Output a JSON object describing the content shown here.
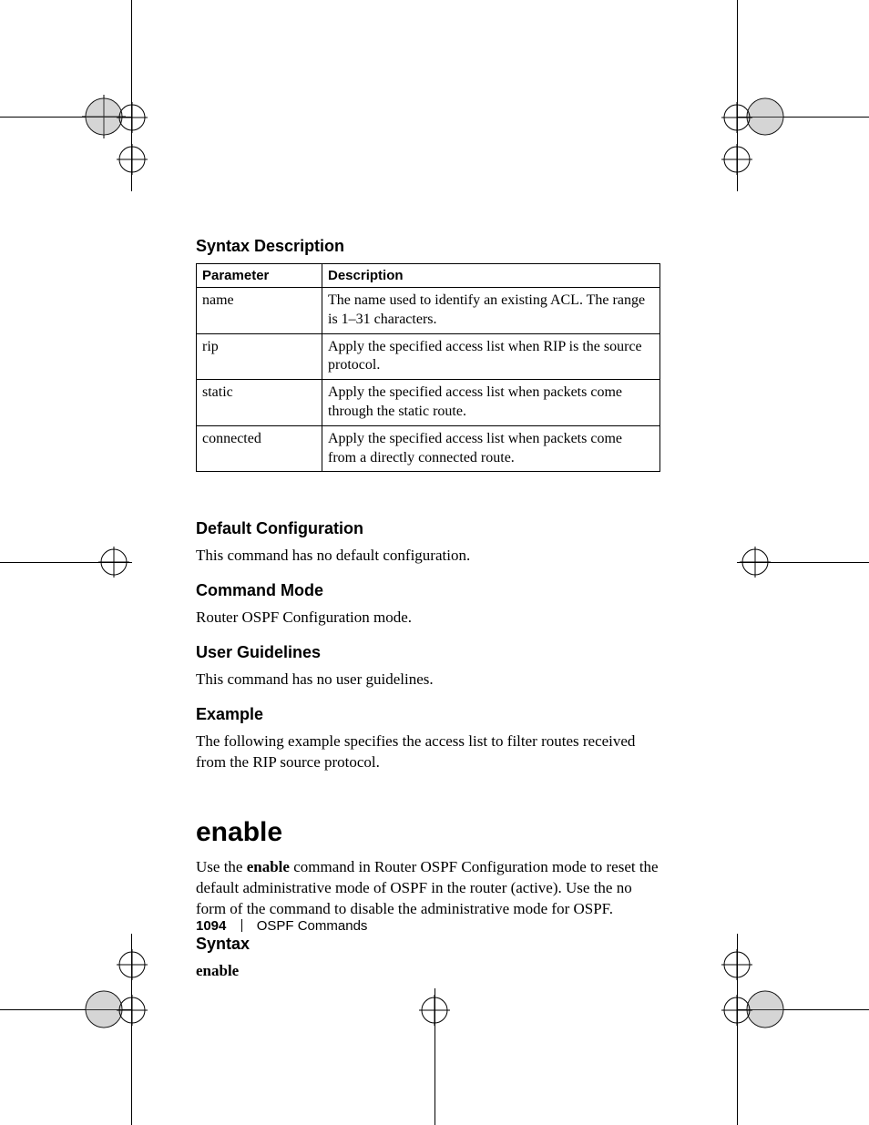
{
  "sections": {
    "syntax_desc_heading": "Syntax Description",
    "table": {
      "header_param": "Parameter",
      "header_desc": "Description",
      "rows": [
        {
          "param": "name",
          "desc": "The name used to identify an existing ACL. The range is 1–31 characters."
        },
        {
          "param": "rip",
          "desc": "Apply the specified access list when RIP is the source protocol."
        },
        {
          "param": "static",
          "desc": "Apply the specified access list when packets come through the static route."
        },
        {
          "param": "connected",
          "desc": "Apply the specified access list when packets come from a directly connected route."
        }
      ]
    },
    "default_cfg_heading": "Default Configuration",
    "default_cfg_text": "This command has no default configuration.",
    "cmd_mode_heading": "Command Mode",
    "cmd_mode_text": "Router OSPF Configuration mode.",
    "user_guide_heading": "User Guidelines",
    "user_guide_text": "This command has no user guidelines.",
    "example_heading": "Example",
    "example_text": "The following example specifies the access list to filter routes received from the RIP source protocol.",
    "enable_heading": "enable",
    "enable_text_pre": "Use the ",
    "enable_bold": "enable",
    "enable_text_post": " command in Router OSPF Configuration mode to reset the default administrative mode of OSPF in the router (active). Use the no form of the command to disable the administrative mode for OSPF.",
    "syntax_heading": "Syntax",
    "syntax_text": "enable"
  },
  "footer": {
    "page_number": "1094",
    "chapter": "OSPF Commands"
  }
}
